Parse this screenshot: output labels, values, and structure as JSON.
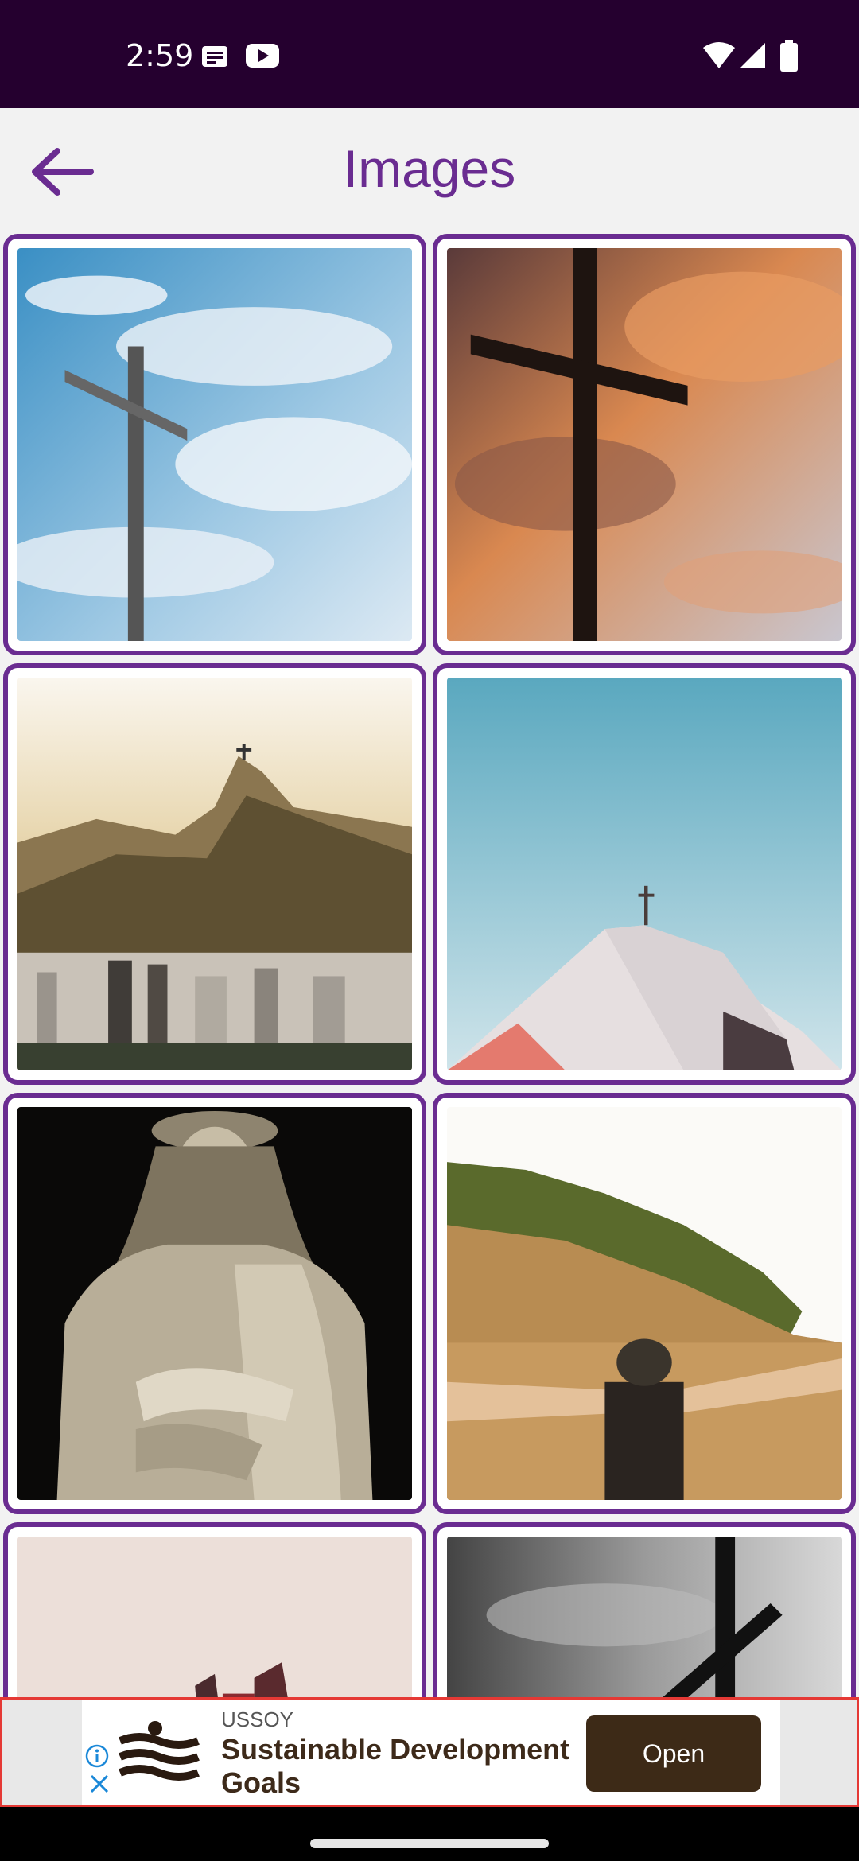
{
  "status_bar": {
    "time": "2:59",
    "icons": [
      "notification-icon",
      "youtube-icon",
      "wifi-icon",
      "signal-icon",
      "battery-icon"
    ]
  },
  "app_bar": {
    "title": "Images",
    "back_icon": "arrow-back-icon"
  },
  "grid": {
    "images": [
      "cross-against-blue-cloudy-sky",
      "cross-silhouette-sunset-clouds",
      "christ-redeemer-mountain-city",
      "church-roof-cross-blue-sky",
      "jesus-crown-of-thorns-statue",
      "man-arms-outstretched-field",
      "red-structure-pale-sky",
      "cross-black-white-clouds"
    ]
  },
  "ad": {
    "advertiser": "USSOY",
    "headline": "Sustainable Development Goals",
    "cta": "Open"
  },
  "colors": {
    "status_bar": "#25002f",
    "accent": "#6a2c91",
    "ad_button": "#3d2a17",
    "ad_border": "#e53935"
  }
}
